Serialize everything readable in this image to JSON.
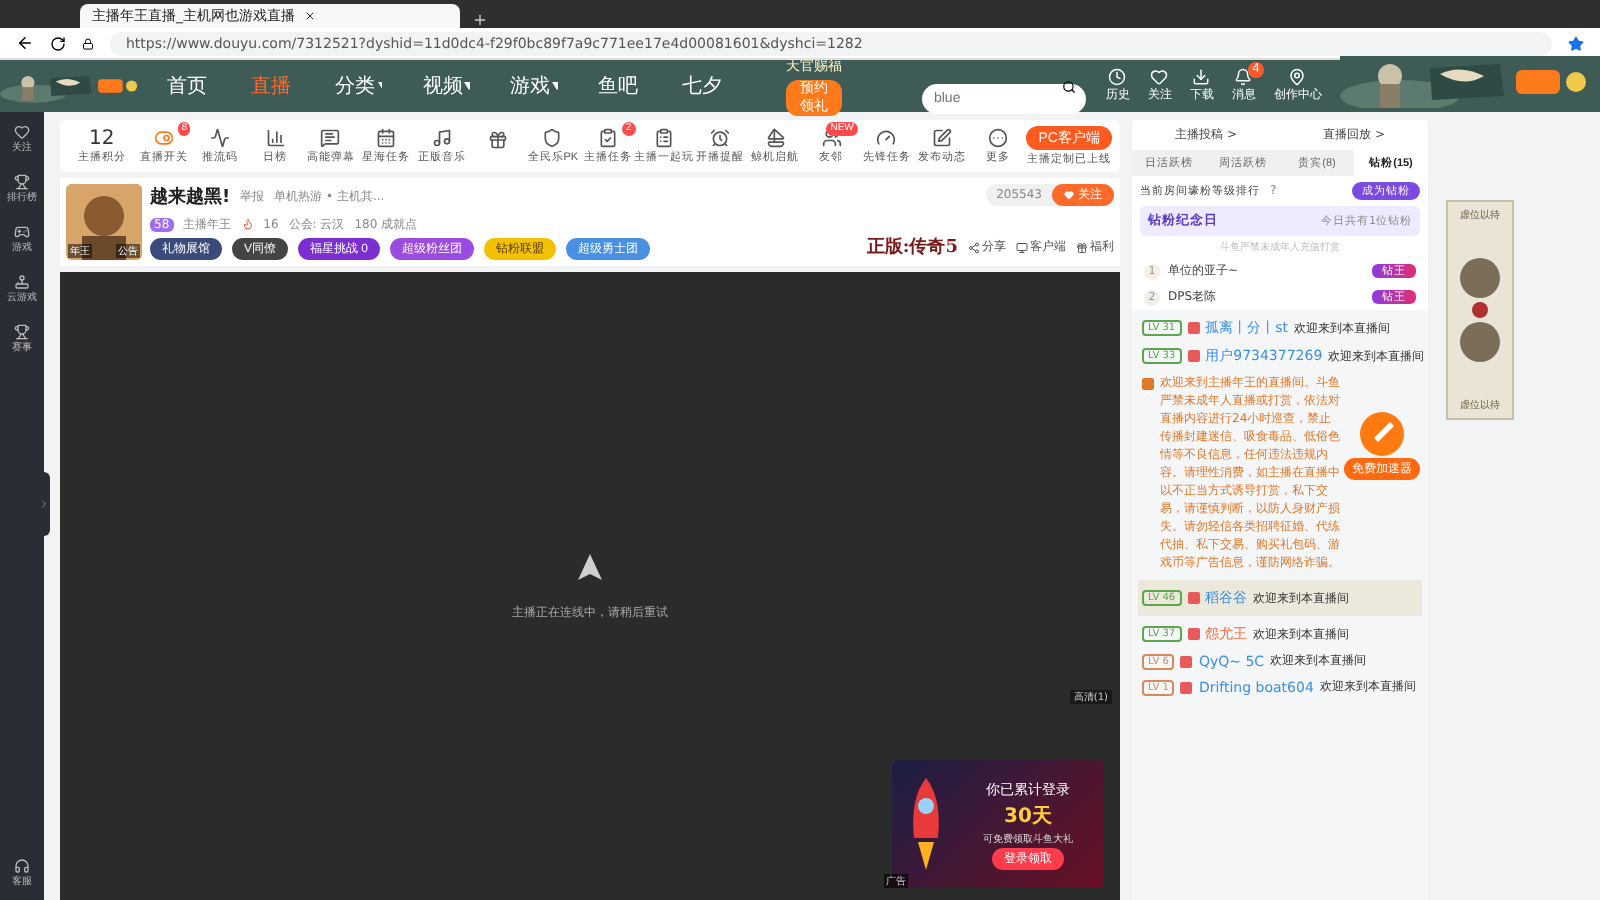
{
  "browser": {
    "tab_title": "主播年王直播_主机网也游戏直播",
    "url": "https://www.douyu.com/7312521?dyshid=11d0dc4-f29f0bc89f7a9c771ee17e4d00081601&dyshci=1282"
  },
  "site_nav": {
    "links": [
      {
        "label": "首页",
        "selected": false,
        "dropdown": false
      },
      {
        "label": "直播",
        "selected": true,
        "dropdown": false
      },
      {
        "label": "分类",
        "selected": false,
        "dropdown": true
      },
      {
        "label": "视频",
        "selected": false,
        "dropdown": true
      },
      {
        "label": "游戏",
        "selected": false,
        "dropdown": true
      },
      {
        "label": "鱼吧",
        "selected": false,
        "dropdown": false
      },
      {
        "label": "七夕",
        "selected": false,
        "dropdown": false
      }
    ],
    "promo": {
      "title": "天官赐福",
      "button": "预约领礼"
    },
    "search": {
      "placeholder": "blue"
    },
    "actions": [
      {
        "label": "历史"
      },
      {
        "label": "关注"
      },
      {
        "label": "下载"
      },
      {
        "label": "消息",
        "badge": "4"
      },
      {
        "label": "创作中心"
      }
    ]
  },
  "sidebar": {
    "items": [
      {
        "label": "关注"
      },
      {
        "label": "排行榜"
      },
      {
        "label": "游戏"
      },
      {
        "label": "云游戏"
      },
      {
        "label": "赛事"
      }
    ],
    "bottom": "客服"
  },
  "toolbar": {
    "score": {
      "value": "12",
      "label": "主播积分"
    },
    "items": [
      {
        "kind": "labeled",
        "label": "直播开关",
        "badge": "8"
      },
      {
        "kind": "labeled",
        "label": "推流码"
      },
      {
        "kind": "labeled",
        "label": "日榜"
      },
      {
        "kind": "labeled",
        "label": "高能弹幕"
      },
      {
        "kind": "labeled",
        "label": "星海任务"
      },
      {
        "kind": "labeled",
        "label": "正版音乐"
      },
      {
        "kind": "icon"
      },
      {
        "kind": "labeled",
        "label": "全民乐PK"
      },
      {
        "kind": "labeled",
        "label": "主播任务",
        "badge": "2"
      },
      {
        "kind": "labeled",
        "label": "主播一起玩"
      },
      {
        "kind": "labeled",
        "label": "开播提醒"
      },
      {
        "kind": "labeled",
        "label": "鲸机启航"
      },
      {
        "kind": "labeled",
        "label": "友邻",
        "badge": "NEW"
      },
      {
        "kind": "labeled",
        "label": "先锋任务"
      },
      {
        "kind": "labeled",
        "label": "发布动态"
      },
      {
        "kind": "labeled",
        "label": "更多"
      }
    ],
    "client_button": "PC客户端",
    "client_note": "主播定制已上线"
  },
  "streamer": {
    "title": "越来越黑!",
    "report": "举报",
    "category": "单机热游 • 主机其...",
    "level": "58",
    "name": "主播年王",
    "heat": "16",
    "guild": "公会: 云汉",
    "achievements": "180 成就点",
    "avatar_caption": "年王",
    "avatar_tag": "公告",
    "badges": [
      {
        "label": "礼物展馆",
        "color": "#3b4a7a"
      },
      {
        "label": "V同僚",
        "color": "#444444"
      },
      {
        "label": "福星挑战 0",
        "color": "#7b2fd0"
      },
      {
        "label": "超级粉丝团",
        "color": "#9b4be0"
      },
      {
        "label": "钻粉联盟",
        "color": "#f2c200"
      },
      {
        "label": "超级勇士团",
        "color": "#4a90e2"
      }
    ],
    "followers": "205543",
    "follow": "关注",
    "game": "正版:传奇5",
    "links": [
      "分享",
      "客户端",
      "福利"
    ]
  },
  "video": {
    "status": "主播正在连线中，请稍后重试",
    "quality": "高清(1)",
    "ad": {
      "title": "你已累计登录",
      "days": "30天",
      "note": "可免费领取斗鱼大礼",
      "button": "登录领取",
      "tag": "广告"
    }
  },
  "right_panel": {
    "links": [
      "主播投稿 >",
      "直播回放 >"
    ],
    "tabs": [
      {
        "label": "日活跃榜",
        "selected": false
      },
      {
        "label": "周活跃榜",
        "selected": false
      },
      {
        "label": "贵宾(8)",
        "selected": false
      },
      {
        "label": "钻粉(15)",
        "selected": true
      }
    ],
    "rank_title": "当前房间壕粉等级排行",
    "rank_help": "?",
    "become": "成为钻粉",
    "anniversary": {
      "title": "钻粉纪念日",
      "note": "今日共有1位钻粉"
    },
    "notice": "斗鱼严禁未成年人充值打赏",
    "ranks": [
      {
        "rank": "1",
        "name": "单位的亚子~",
        "badge": "钻王"
      },
      {
        "rank": "2",
        "name": "DPS老陈",
        "badge": "钻王"
      }
    ],
    "chat": [
      {
        "kind": "welcome",
        "level": {
          "text": "LV 31",
          "color": "#5aa84a"
        },
        "name": "孤离丨分丨st",
        "color": "#3a8ee6",
        "text": "欢迎来到本直播间",
        "highlighted": false
      },
      {
        "kind": "welcome",
        "level": {
          "text": "LV 33",
          "color": "#5aa84a"
        },
        "name": "用户9734377269",
        "color": "#3a8ee6",
        "text": "欢迎来到本直播间",
        "highlighted": false
      },
      {
        "kind": "system",
        "text": "欢迎来到主播年王的直播间。斗鱼严禁未成年人直播或打赏，依法对直播内容进行24小时巡查，禁止传播封建迷信、吸食毒品、低俗色情等不良信息，任何违法违规内容。请理性消费，如主播在直播中以不正当方式诱导打赏，私下交易，请谨慎判断，以防人身财产损失。请勿轻信各类招聘征婚、代练代抽、私下交易、购买礼包码、游戏币等广告信息，谨防网络诈骗。"
      },
      {
        "kind": "welcome",
        "level": {
          "text": "LV 46",
          "color": "#5aa84a"
        },
        "name": "稻谷谷",
        "color": "#3a8ee6",
        "text": "欢迎来到本直播间",
        "highlighted": true
      },
      {
        "kind": "welcome",
        "level": {
          "text": "LV 37",
          "color": "#5aa84a"
        },
        "name": "怨尤王",
        "color": "#f06a3a",
        "text": "欢迎来到本直播间",
        "highlighted": false
      },
      {
        "kind": "welcome",
        "level": {
          "text": "LV 6",
          "color": "#d98a5a"
        },
        "name": "QyQ~ 5C",
        "color": "#3a8ee6",
        "text": "欢迎来到本直播间",
        "highlighted": false
      },
      {
        "kind": "welcome",
        "level": {
          "text": "LV 1",
          "color": "#d98a5a"
        },
        "name": "Drifting boat604",
        "color": "#3a8ee6",
        "text": "欢迎来到本直播间",
        "highlighted": false
      }
    ],
    "booster": "免费加速器"
  },
  "side_ad": {
    "labels": [
      "虚位以待",
      "虚位以待"
    ]
  }
}
